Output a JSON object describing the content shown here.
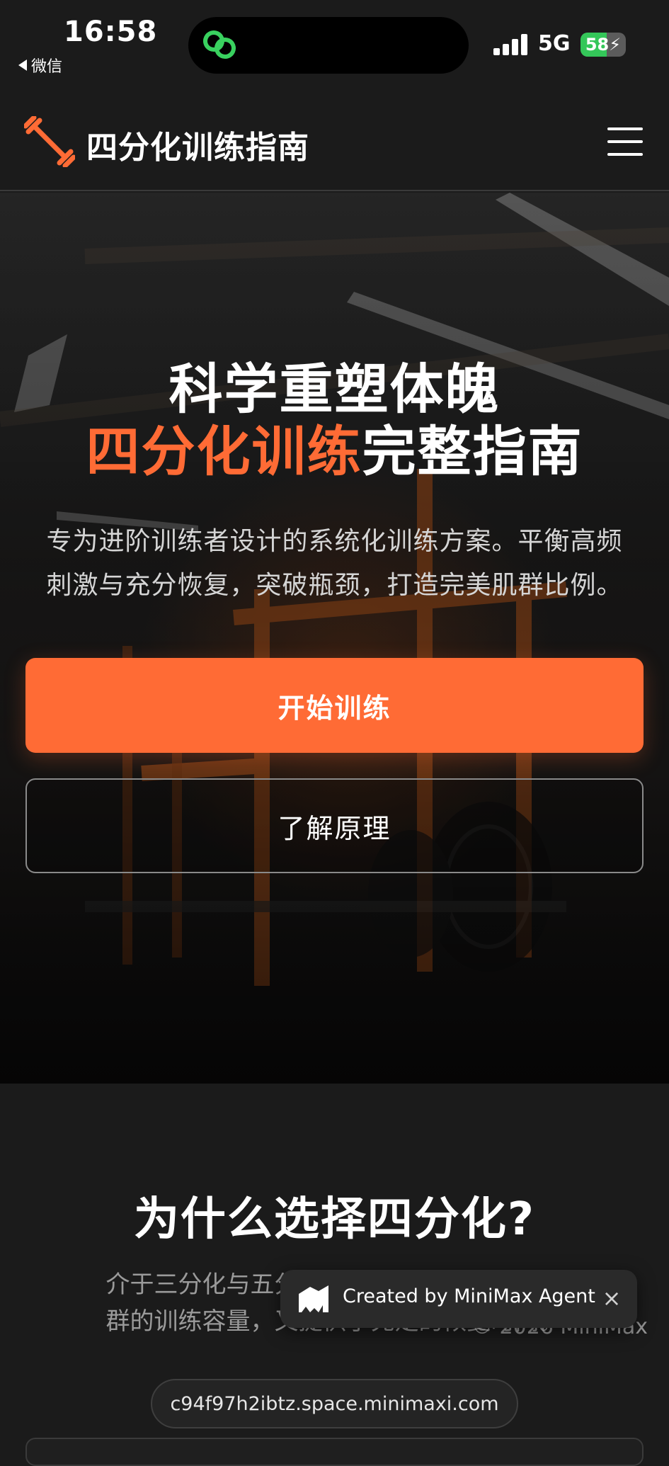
{
  "status_bar": {
    "time": "16:58",
    "back_app": "微信",
    "network": "5G",
    "battery_percent": 58,
    "battery_text": "58"
  },
  "navbar": {
    "title": "四分化训练指南",
    "logo_icon": "dumbbell-icon",
    "menu_icon": "hamburger-menu-icon"
  },
  "hero": {
    "title_line1": "科学重塑体魄",
    "title_line2_accent": "四分化训练",
    "title_line2_rest": "完整指南",
    "subtitle_line1": "专为进阶训练者设计的系统化训练方案。平衡高频",
    "subtitle_line2": "刺激与充分恢复，突破瓶颈，打造完美肌群比例。",
    "primary_button": "开始训练",
    "secondary_button": "了解原理"
  },
  "why": {
    "title": "为什么选择四分化?",
    "text_line1": "介于三分化与五分化之间，既保证了每个肌",
    "text_line2": "群的训练容量，又提供了充足的恢复时间。"
  },
  "badge": {
    "text": "Created by MiniMax Agent",
    "close": "×",
    "copyright": "© 2026 MiniMax"
  },
  "browser": {
    "url": "c94f97h2ibtz.space.minimaxi.com"
  },
  "colors": {
    "accent": "#ff6b35",
    "background": "#1b1b1b",
    "battery_green": "#34c759"
  }
}
